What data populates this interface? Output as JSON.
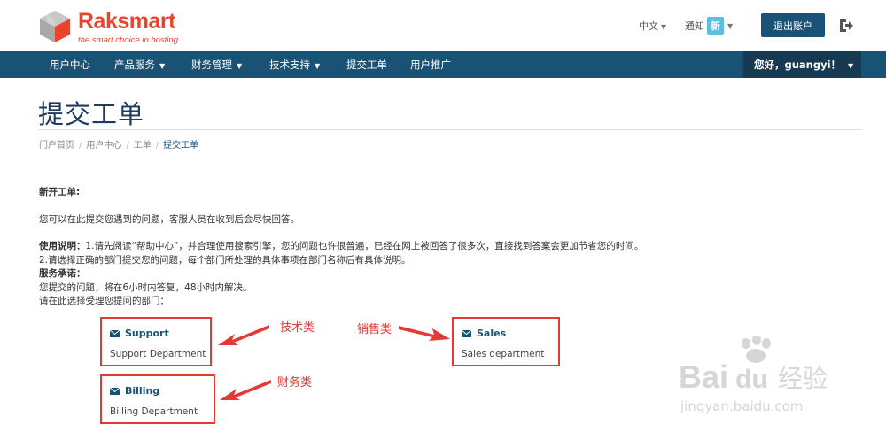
{
  "header": {
    "logo_name": "Raksmart",
    "logo_tagline": "the smart choice in hosting",
    "language": "中文",
    "notice_label": "通知",
    "notice_badge": "新",
    "logout_label": "退出账户"
  },
  "nav": {
    "items": [
      {
        "label": "用户中心",
        "dropdown": false
      },
      {
        "label": "产品服务",
        "dropdown": true
      },
      {
        "label": "财务管理",
        "dropdown": true
      },
      {
        "label": "技术支持",
        "dropdown": true
      },
      {
        "label": "提交工单",
        "dropdown": false
      },
      {
        "label": "用户推广",
        "dropdown": false
      }
    ],
    "greeting": "您好，guangyi！"
  },
  "page": {
    "title": "提交工单",
    "breadcrumb": [
      "门户首页",
      "用户中心",
      "工单",
      "提交工单"
    ]
  },
  "content": {
    "heading": "新开工单:",
    "intro": "您可以在此提交您遇到的问题，客服人员在收到后会尽快回答。",
    "usage_label": "使用说明：",
    "usage_1": "1.请先阅读“帮助中心”，并合理使用搜索引擎，您的问题也许很普遍，已经在网上被回答了很多次，直接找到答案会更加节省您的时间。",
    "usage_2": "2.请选择正确的部门提交您的问题，每个部门所处理的具体事项在部门名称后有具体说明。",
    "promise_label": "服务承诺：",
    "promise_text": "您提交的问题，将在6小时内答复，48小时内解决。",
    "select_prompt": "请在此选择受理您提问的部门："
  },
  "departments": [
    {
      "name": "Support",
      "desc": "Support Department"
    },
    {
      "name": "Sales",
      "desc": "Sales department"
    },
    {
      "name": "Billing",
      "desc": "Billing Department"
    }
  ],
  "annotations": {
    "tech": "技术类",
    "sales": "销售类",
    "finance": "财务类"
  },
  "watermark": {
    "brand": "Bai",
    "brand_tail": "du",
    "brand_cn": "经验",
    "url": "jingyan.baidu.com"
  },
  "colors": {
    "primary": "#1a5276",
    "brand_red": "#e8452c",
    "annotation_red": "#e53935",
    "badge": "#5bc0de"
  }
}
